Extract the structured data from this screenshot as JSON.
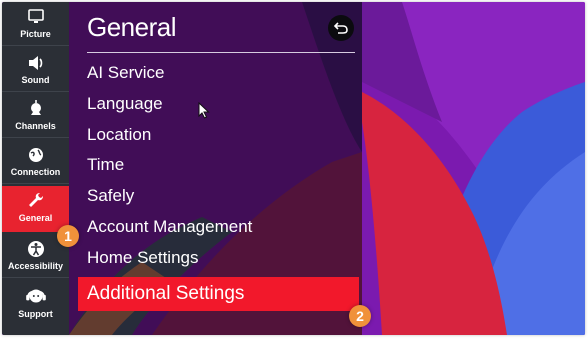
{
  "sidebar": {
    "items": [
      {
        "label": "Picture",
        "icon": "picture-icon"
      },
      {
        "label": "Sound",
        "icon": "speaker-icon"
      },
      {
        "label": "Channels",
        "icon": "antenna-icon"
      },
      {
        "label": "Connection",
        "icon": "globe-icon"
      },
      {
        "label": "General",
        "icon": "wrench-icon"
      },
      {
        "label": "Accessibility",
        "icon": "accessibility-icon"
      },
      {
        "label": "Support",
        "icon": "headset-icon"
      }
    ],
    "active": "General"
  },
  "panel": {
    "title": "General",
    "back_icon": "back-arrow-icon",
    "items": [
      "AI Service",
      "Language",
      "Location",
      "Time",
      "Safely",
      "Account Management",
      "Home Settings",
      "Additional Settings"
    ],
    "selected": "Additional Settings"
  },
  "badges": {
    "step1": "1",
    "step2": "2"
  },
  "colors": {
    "accent": "#f2182b",
    "badge": "#f0913a",
    "sidebar": "#2b2f36",
    "background": "#7a1bb0"
  }
}
